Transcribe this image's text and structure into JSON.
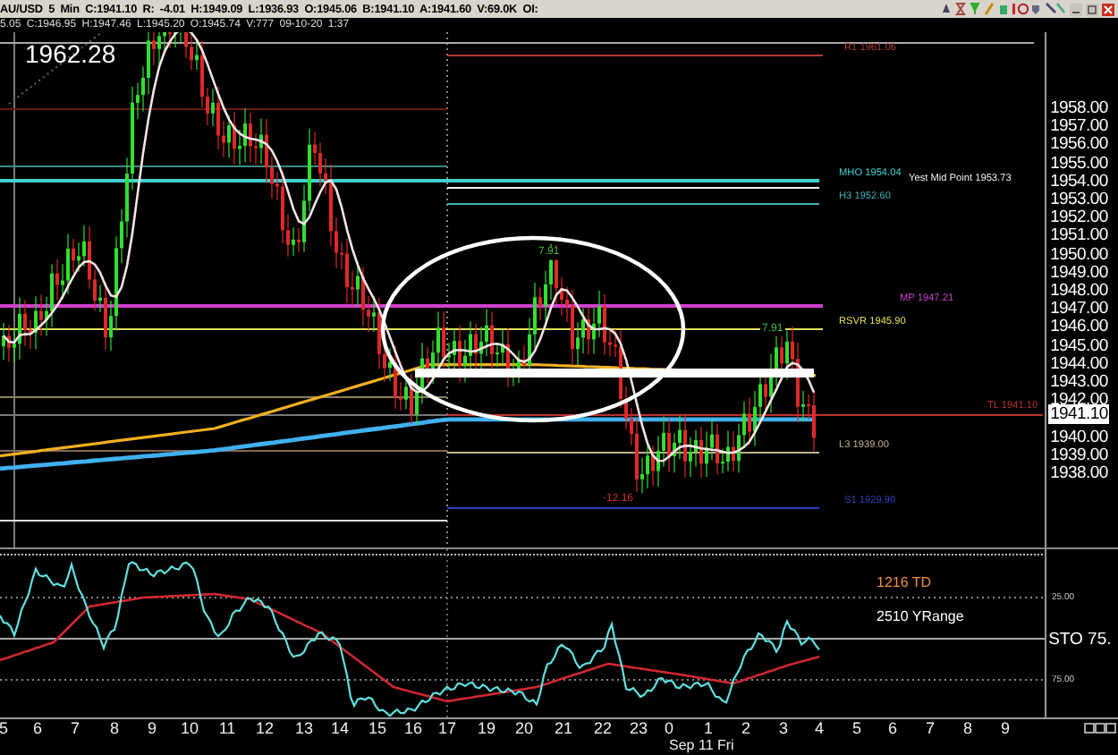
{
  "title_bar": {
    "text": "AU/USD 5 Min C:1941.10 R: -4.01 H:1949.09 L:1936.93 O:1945.06 B:1941.10 A:1941.60 V:69.0K OI:"
  },
  "info_line": {
    "text": "5.05 C:1946.95 H:1947.46 L:1945.20 O:1945.74 V:777 09-10-20 1:37"
  },
  "price_panel": {
    "high_label": "1962.28",
    "level_labels": [
      {
        "text": "R1 1961.06",
        "color": "#b03838"
      },
      {
        "text": "MHO 1954.04",
        "color": "#40d0d0"
      },
      {
        "text": "Yest Mid Point 1953.73",
        "color": "#f0f0f0"
      },
      {
        "text": "H3 1952.60",
        "color": "#40b0b0"
      },
      {
        "text": "MP 1947.21",
        "color": "#d040d0"
      },
      {
        "text": "RSVR 1945.90",
        "color": "#e0e060"
      },
      {
        "text": "TL 1941.10",
        "color": "#c03030"
      },
      {
        "text": "L3 1939.00",
        "color": "#c0b090"
      },
      {
        "text": "S1 1929.90",
        "color": "#3040c0"
      }
    ],
    "wave_labels": [
      {
        "text": "7.91",
        "color": "#40c040"
      },
      {
        "text": "7.91",
        "color": "#40c040"
      },
      {
        "text": "-12.16",
        "color": "#d03030"
      }
    ],
    "price_axis": [
      "1958.00",
      "1957.00",
      "1956.00",
      "1955.00",
      "1954.00",
      "1953.00",
      "1952.00",
      "1951.00",
      "1950.00",
      "1949.00",
      "1948.00",
      "1947.00",
      "1946.00",
      "1945.00",
      "1944.00",
      "1943.00",
      "1942.00",
      "1940.00",
      "1939.00",
      "1938.00"
    ],
    "current_price": "1941.10"
  },
  "oscillator_panel": {
    "indicator_labels": [
      {
        "text": "1216 TD",
        "color": "#f09040"
      },
      {
        "text": "2510 YRange",
        "color": "#ffffff"
      }
    ],
    "axis_labels": [
      "25.00",
      "75.00"
    ],
    "readout": "STO 75."
  },
  "time_axis": {
    "ticks": [
      "5",
      "6",
      "7",
      "8",
      "9",
      "10",
      "11",
      "12",
      "13",
      "14",
      "15",
      "16",
      "17",
      "19",
      "20",
      "21",
      "22",
      "23",
      "0",
      "1",
      "2",
      "3",
      "4",
      "5",
      "6",
      "7",
      "8",
      "9"
    ],
    "date": "Sep 11 Fri"
  }
}
